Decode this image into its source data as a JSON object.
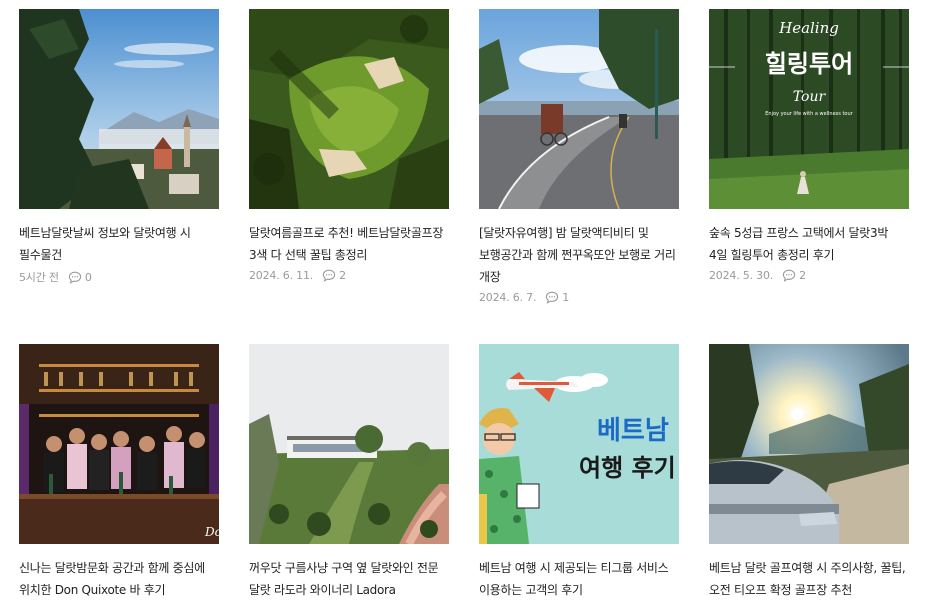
{
  "posts": [
    {
      "title": "베트남달랏날씨 정보와 달랏여행 시 필수물건",
      "date": "5시간 전",
      "comments": "0",
      "image": "dalat-town-view"
    },
    {
      "title": "달랏여름골프로 추천! 베트남달랏골프장 3색 다 선택 꿀팁 총정리",
      "date": "2024. 6. 11.",
      "comments": "2",
      "image": "golf-course-aerial"
    },
    {
      "title": "[달랏자유여행] 밤 달랏액티비티 및 보행공간과 함께 쩐꾸옥또안 보행로 거리 개장",
      "date": "2024. 6. 7.",
      "comments": "1",
      "image": "lakeside-road-cyclo"
    },
    {
      "title": "숲속 5성급 프랑스 고택에서 달랏3박 4일 힐링투어 총정리 후기",
      "date": "2024. 5. 30.",
      "comments": "2",
      "image": "pine-forest-healing"
    },
    {
      "title": "신나는 달랏밤문화 공간과 함께 중심에 위치한 Don Quixote 바 후기",
      "image": "bar-staff-group"
    },
    {
      "title": "꺼우닷 구름사냥 구역 옆 달랏와인 전문 달랏 라도라 와이너리 Ladora",
      "image": "winery-building"
    },
    {
      "title": "베트남 여행 시 제공되는 티그룹 서비스 이용하는 고객의 후기",
      "image": "travel-review-illustration"
    },
    {
      "title": "베트남 달랏 골프여행 시 주의사항, 꿀팁, 오전 티오프 확정 골프장 추천",
      "image": "car-sunrise"
    }
  ],
  "thumb_text": {
    "healing_script": "Healing",
    "healing_main": "힐링투어",
    "healing_tour": "Tour",
    "healing_small": "Enjoy your life with a wellness tour",
    "review_line1": "베트남",
    "review_line2": "여행 후기",
    "bar_sign": "Do"
  }
}
